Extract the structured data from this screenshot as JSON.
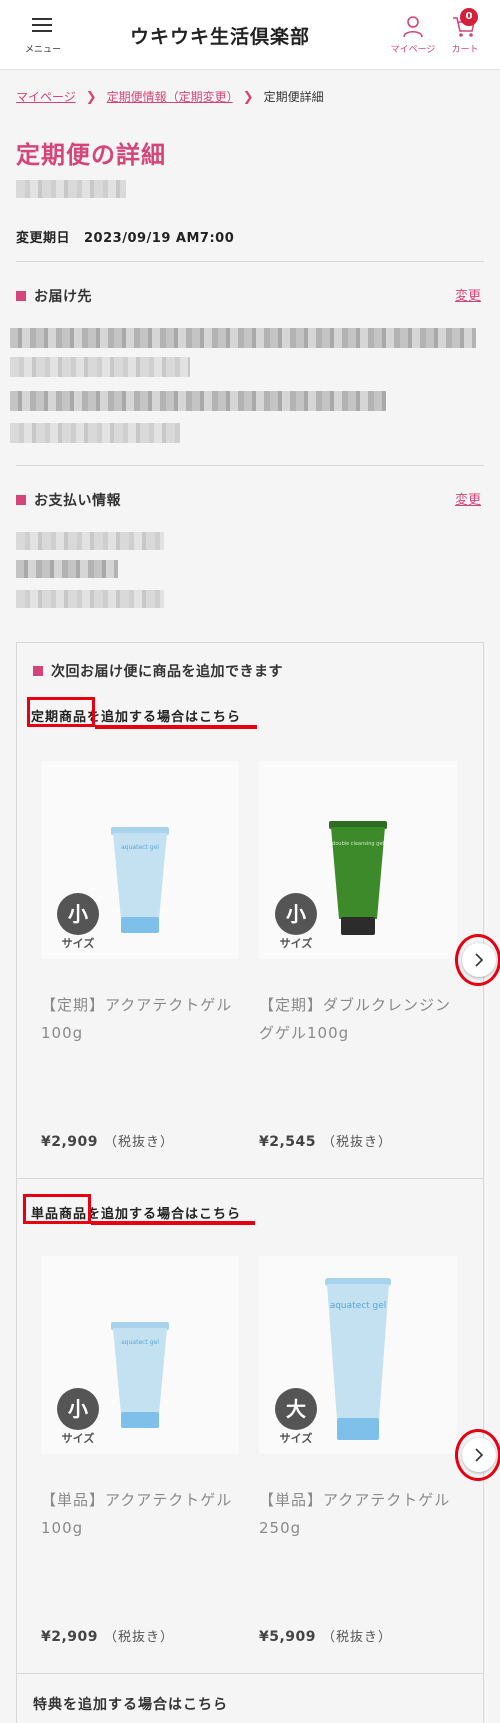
{
  "header": {
    "menu_label": "メニュー",
    "logo": "ウキウキ生活倶楽部",
    "mypage_label": "マイページ",
    "cart_label": "カート",
    "cart_count": "0"
  },
  "breadcrumb": {
    "items": [
      "マイページ",
      "定期便情報（定期変更）"
    ],
    "current": "定期便詳細"
  },
  "page_title": "定期便の詳細",
  "change_date": {
    "label": "変更期日",
    "value": "2023/09/19 AM7:00"
  },
  "delivery": {
    "heading": "お届け先",
    "change_link": "変更"
  },
  "payment": {
    "heading": "お支払い情報",
    "change_link": "変更"
  },
  "add_section": {
    "title": "次回お届け便に商品を追加できます",
    "regular": {
      "heading_highlight": "定期商品",
      "heading_rest": "を追加する場合はこちら",
      "products": [
        {
          "size": "小",
          "size_label": "サイズ",
          "name": "【定期】アクアテクトゲル100g",
          "price": "¥2,909",
          "tax": "（税抜き）",
          "tube_color": "blue",
          "tube_text": "aquatect gel"
        },
        {
          "size": "小",
          "size_label": "サイズ",
          "name": "【定期】ダブルクレンジングゲル100g",
          "price": "¥2,545",
          "tax": "（税抜き）",
          "tube_color": "green",
          "tube_text": "double cleansing gel"
        }
      ]
    },
    "single": {
      "heading_highlight": "単品商品",
      "heading_rest": "を追加する場合はこちら",
      "products": [
        {
          "size": "小",
          "size_label": "サイズ",
          "name": "【単品】アクアテクトゲル100g",
          "price": "¥2,909",
          "tax": "（税抜き）",
          "tube_color": "blue",
          "tube_text": "aquatect gel"
        },
        {
          "size": "大",
          "size_label": "サイズ",
          "name": "【単品】アクアテクトゲル250g",
          "price": "¥5,909",
          "tax": "（税抜き）",
          "tube_color": "blue",
          "tube_text": "aquatect gel"
        }
      ]
    },
    "bonus_heading": "特典を追加する場合はこちら"
  },
  "colors": {
    "accent": "#d6457a",
    "annotation_red": "#e60012",
    "cart_badge": "#d41e3b"
  }
}
